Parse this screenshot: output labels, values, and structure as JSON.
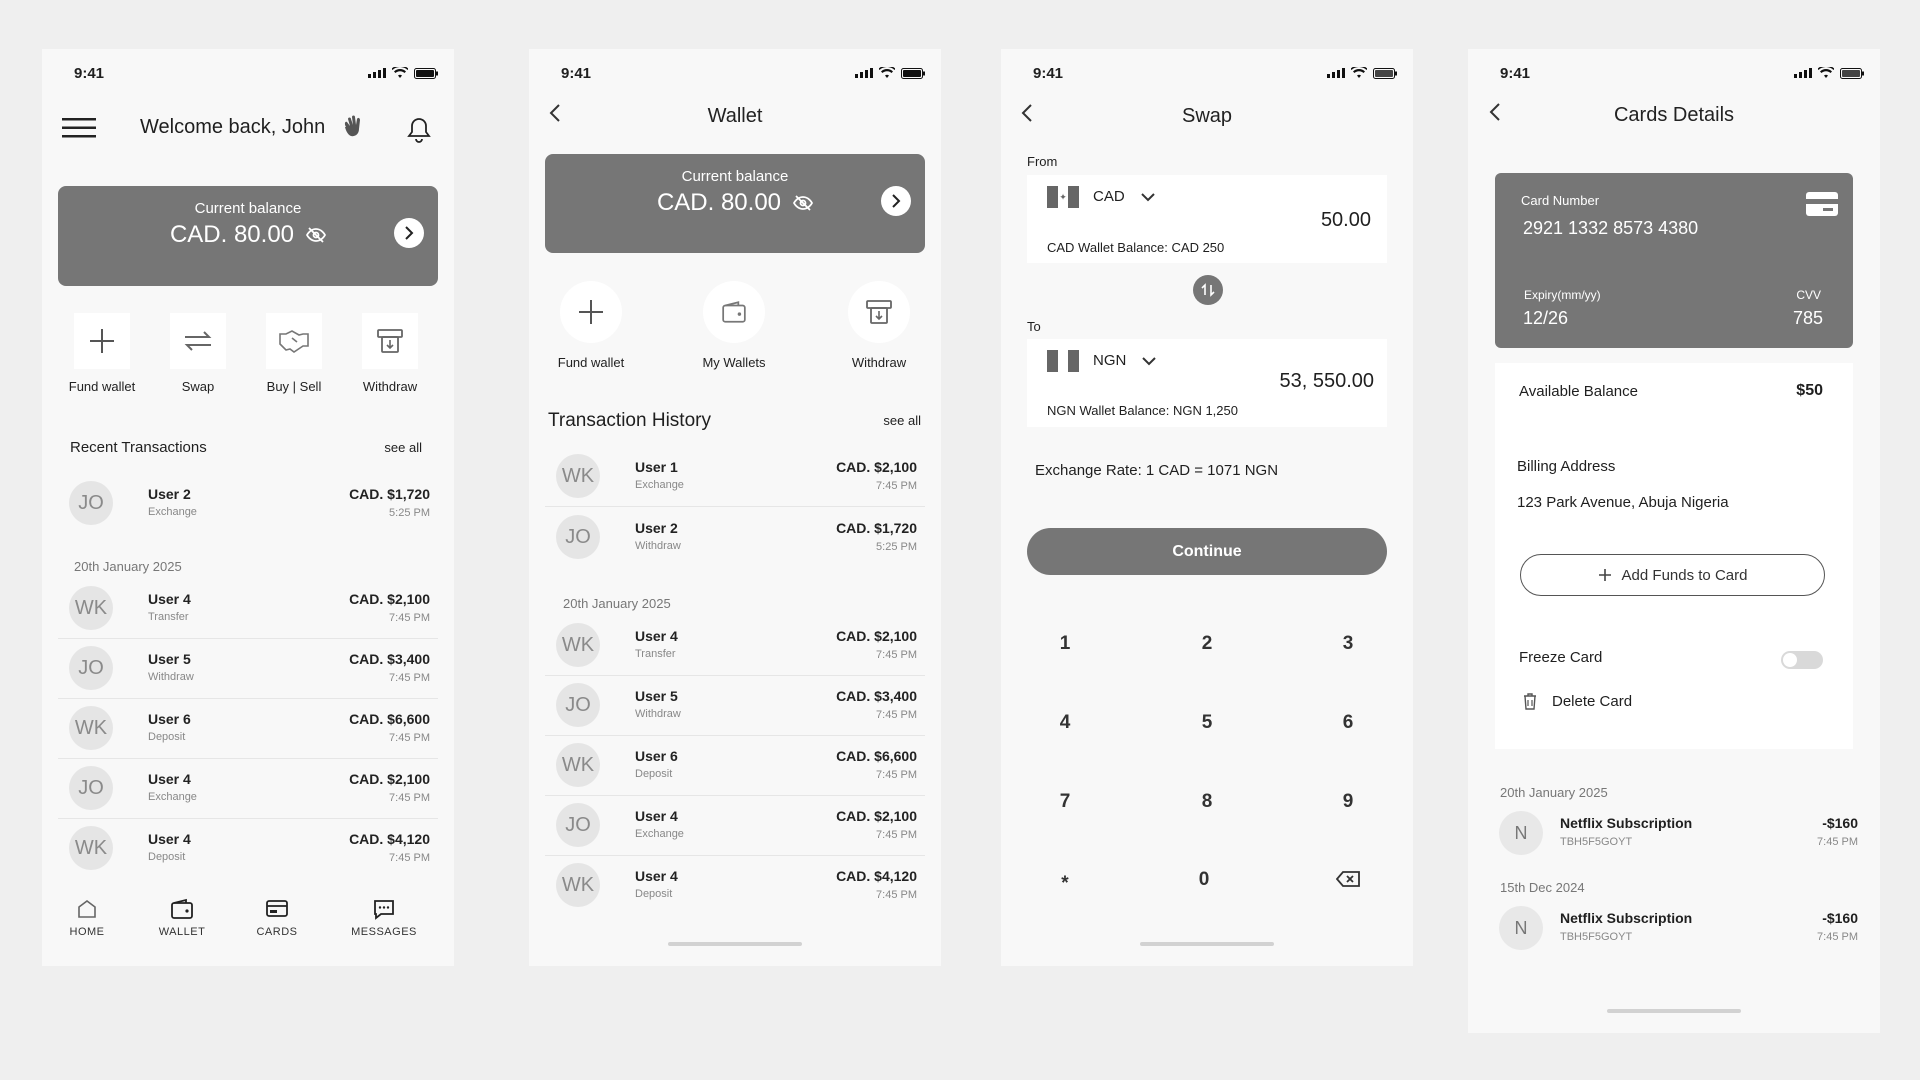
{
  "status": {
    "time": "9:41"
  },
  "home": {
    "welcome": "Welcome back, John",
    "balance_label": "Current balance",
    "balance_amount": "CAD. 80.00",
    "actions": [
      "Fund wallet",
      "Swap",
      "Buy | Sell",
      "Withdraw"
    ],
    "recent_title": "Recent Transactions",
    "see_all": "see all",
    "top_txn": {
      "initials": "JO",
      "name": "User 2",
      "type": "Exchange",
      "amount": "CAD.  $1,720",
      "time": "5:25 PM"
    },
    "date": "20th January 2025",
    "txns": [
      {
        "initials": "WK",
        "name": "User 4",
        "type": "Transfer",
        "amount": "CAD.  $2,100",
        "time": "7:45 PM"
      },
      {
        "initials": "JO",
        "name": "User 5",
        "type": "Withdraw",
        "amount": "CAD.  $3,400",
        "time": "7:45 PM"
      },
      {
        "initials": "WK",
        "name": "User 6",
        "type": "Deposit",
        "amount": "CAD.  $6,600",
        "time": "7:45 PM"
      },
      {
        "initials": "JO",
        "name": "User 4",
        "type": "Exchange",
        "amount": "CAD.  $2,100",
        "time": "7:45 PM"
      },
      {
        "initials": "WK",
        "name": "User 4",
        "type": "Deposit",
        "amount": "CAD.  $4,120",
        "time": "7:45 PM"
      }
    ],
    "nav": [
      "HOME",
      "WALLET",
      "CARDS",
      "MESSAGES"
    ]
  },
  "wallet": {
    "title": "Wallet",
    "balance_label": "Current balance",
    "balance_amount": "CAD. 80.00",
    "actions": [
      "Fund wallet",
      "My Wallets",
      "Withdraw"
    ],
    "history_title": "Transaction History",
    "see_all": "see all",
    "top_txns": [
      {
        "initials": "WK",
        "name": "User 1",
        "type": "Exchange",
        "amount": "CAD.  $2,100",
        "time": "7:45 PM"
      },
      {
        "initials": "JO",
        "name": "User 2",
        "type": "Withdraw",
        "amount": "CAD.  $1,720",
        "time": "5:25 PM"
      }
    ],
    "date": "20th January 2025",
    "txns": [
      {
        "initials": "WK",
        "name": "User 4",
        "type": "Transfer",
        "amount": "CAD.  $2,100",
        "time": "7:45 PM"
      },
      {
        "initials": "JO",
        "name": "User 5",
        "type": "Withdraw",
        "amount": "CAD.  $3,400",
        "time": "7:45 PM"
      },
      {
        "initials": "WK",
        "name": "User 6",
        "type": "Deposit",
        "amount": "CAD.  $6,600",
        "time": "7:45 PM"
      },
      {
        "initials": "JO",
        "name": "User 4",
        "type": "Exchange",
        "amount": "CAD.  $2,100",
        "time": "7:45 PM"
      },
      {
        "initials": "WK",
        "name": "User 4",
        "type": "Deposit",
        "amount": "CAD.  $4,120",
        "time": "7:45 PM"
      }
    ]
  },
  "swap": {
    "title": "Swap",
    "from_label": "From",
    "from_currency": "CAD",
    "from_amount": "50.00",
    "from_balance": "CAD Wallet Balance:  CAD 250",
    "to_label": "To",
    "to_currency": "NGN",
    "to_amount": "53, 550.00",
    "to_balance": "NGN Wallet Balance:   NGN 1,250",
    "rate": "Exchange Rate:  1 CAD  = 1071 NGN",
    "continue": "Continue",
    "keys": [
      "1",
      "2",
      "3",
      "4",
      "5",
      "6",
      "7",
      "8",
      "9",
      "*",
      "0"
    ]
  },
  "cards": {
    "title": "Cards Details",
    "card_number_label": "Card Number",
    "card_number": "2921 1332 8573 4380",
    "expiry_label": "Expiry(mm/yy)",
    "expiry": "12/26",
    "cvv_label": "CVV",
    "cvv": "785",
    "available_label": "Available Balance",
    "available": "$50",
    "billing_label": "Billing Address",
    "billing": "123 Park Avenue, Abuja Nigeria",
    "add_funds": "Add Funds to Card",
    "freeze": "Freeze Card",
    "freeze_on": false,
    "delete": "Delete Card",
    "groups": [
      {
        "date": "20th January 2025",
        "initial": "N",
        "name": "Netflix Subscription",
        "ref": "TBH5F5GOYT",
        "amount": "-$160",
        "time": "7:45 PM"
      },
      {
        "date": "15th Dec 2024",
        "initial": "N",
        "name": "Netflix Subscription",
        "ref": "TBH5F5GOYT",
        "amount": "-$160",
        "time": "7:45 PM"
      }
    ]
  },
  "colors": {
    "card": "#767676",
    "bg": "#f8f8f8",
    "page": "#efefef"
  }
}
